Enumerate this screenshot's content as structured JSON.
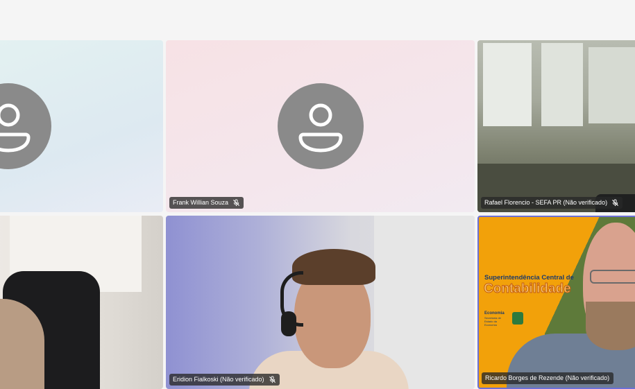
{
  "participants": [
    {
      "name": "",
      "video": false,
      "muted": false,
      "avatar_icon": "person-icon"
    },
    {
      "name": "Frank Willian Souza",
      "video": false,
      "muted": true,
      "avatar_icon": "person-icon"
    },
    {
      "name": "Rafael Florencio - SEFA PR (Não verificado)",
      "video": true,
      "muted": true
    },
    {
      "name": "",
      "video": true,
      "muted": false
    },
    {
      "name": "Eridion Fialkoski (Não verificado)",
      "video": true,
      "muted": true
    },
    {
      "name": "Ricardo Borges de Rezende (Não verificado)",
      "video": true,
      "muted": false,
      "speaking": true
    }
  ],
  "slide": {
    "line1": "Superintendência Central de",
    "line2": "Contabilidade",
    "logo_text": "Economia",
    "logo_sub": "Secretaria de Estado da Economia"
  },
  "colors": {
    "avatar_bg": "#8a8a8a",
    "nameplate_bg": "#282828",
    "speaking_border": "#6b6fd6",
    "slide_orange": "#f2a10a"
  },
  "icons": {
    "mic_muted": "mic-off-icon"
  }
}
